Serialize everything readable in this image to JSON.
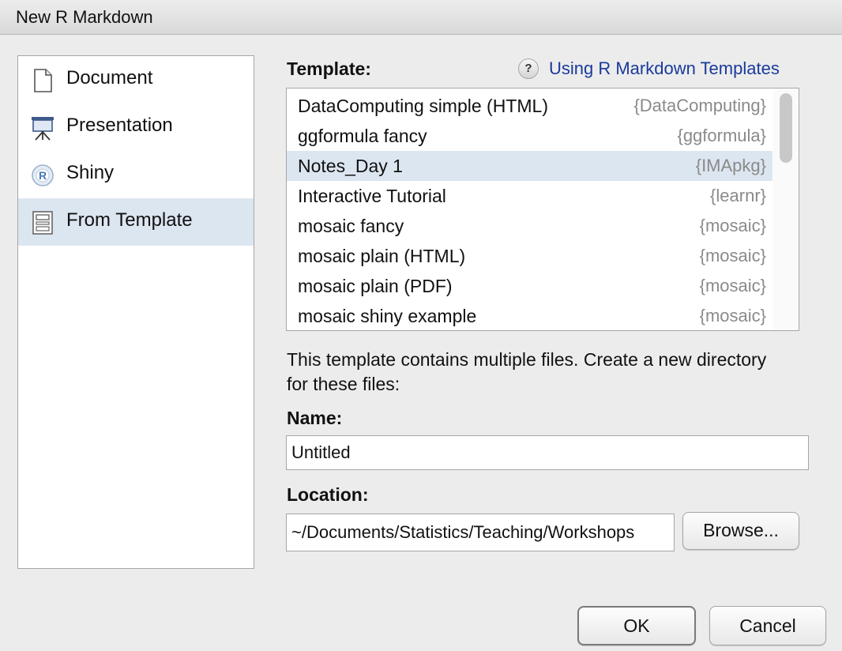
{
  "window": {
    "title": "New R Markdown"
  },
  "sidebar": {
    "items": [
      {
        "label": "Document",
        "icon": "document-icon",
        "selected": false
      },
      {
        "label": "Presentation",
        "icon": "presentation-icon",
        "selected": false
      },
      {
        "label": "Shiny",
        "icon": "shiny-icon",
        "selected": false
      },
      {
        "label": "From Template",
        "icon": "template-icon",
        "selected": true
      }
    ]
  },
  "template_section": {
    "label": "Template:",
    "help_icon": "?",
    "help_link": "Using R Markdown Templates",
    "items": [
      {
        "name": "DataComputing simple (HTML)",
        "package": "{DataComputing}",
        "selected": false
      },
      {
        "name": "ggformula fancy",
        "package": "{ggformula}",
        "selected": false
      },
      {
        "name": "Notes_Day 1",
        "package": "{IMApkg}",
        "selected": true
      },
      {
        "name": "Interactive Tutorial",
        "package": "{learnr}",
        "selected": false
      },
      {
        "name": "mosaic fancy",
        "package": "{mosaic}",
        "selected": false
      },
      {
        "name": "mosaic plain (HTML)",
        "package": "{mosaic}",
        "selected": false
      },
      {
        "name": "mosaic plain (PDF)",
        "package": "{mosaic}",
        "selected": false
      },
      {
        "name": "mosaic shiny example",
        "package": "{mosaic}",
        "selected": false
      }
    ]
  },
  "info_text": "This template contains multiple files. Create a new directory for these files:",
  "name_field": {
    "label": "Name:",
    "value": "Untitled"
  },
  "location_field": {
    "label": "Location:",
    "value": "~/Documents/Statistics/Teaching/Workshops"
  },
  "buttons": {
    "browse": "Browse...",
    "ok": "OK",
    "cancel": "Cancel"
  },
  "colors": {
    "selection": "#dce6f0",
    "link": "#1a3a9c",
    "package_text": "#8a8a8a"
  }
}
